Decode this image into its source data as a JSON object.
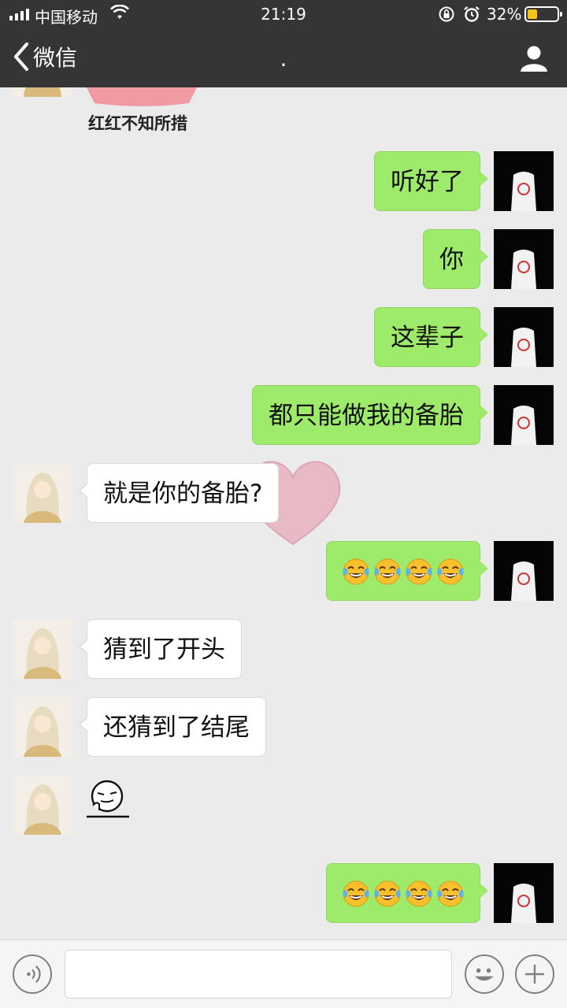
{
  "status_bar": {
    "carrier": "中国移动",
    "time": "21:19",
    "battery_percent": "32%",
    "battery_level": 0.32,
    "icons": [
      "signal-icon",
      "wifi-icon",
      "orientation-lock-icon",
      "alarm-icon",
      "battery-icon"
    ]
  },
  "nav": {
    "back_label": "微信",
    "title": ".",
    "icons": [
      "back-chevron-icon",
      "profile-icon"
    ]
  },
  "sticker_top": {
    "caption": "红红不知所措"
  },
  "messages": [
    {
      "side": "right",
      "text": "听好了"
    },
    {
      "side": "right",
      "text": "你"
    },
    {
      "side": "right",
      "text": "这辈子"
    },
    {
      "side": "right",
      "text": "都只能做我的备胎"
    },
    {
      "side": "left",
      "text": "就是你的备胎?"
    },
    {
      "side": "right",
      "emoji": "face-with-tears-of-joy",
      "emoji_count": 4
    },
    {
      "side": "left",
      "text": "猜到了开头"
    },
    {
      "side": "left",
      "text": "还猜到了结尾"
    },
    {
      "side": "left",
      "sticker": "sly-smile-sticker"
    },
    {
      "side": "right",
      "emoji": "face-with-tears-of-joy",
      "emoji_count": 4
    }
  ],
  "input_bar": {
    "value": "",
    "icons": [
      "voice-icon",
      "emoji-icon",
      "plus-icon"
    ]
  },
  "colors": {
    "header_bg": "#353535",
    "chat_bg": "#ebebeb",
    "sent_bubble": "#9eea6a",
    "received_bubble": "#ffffff",
    "battery_fill": "#f5c518"
  }
}
